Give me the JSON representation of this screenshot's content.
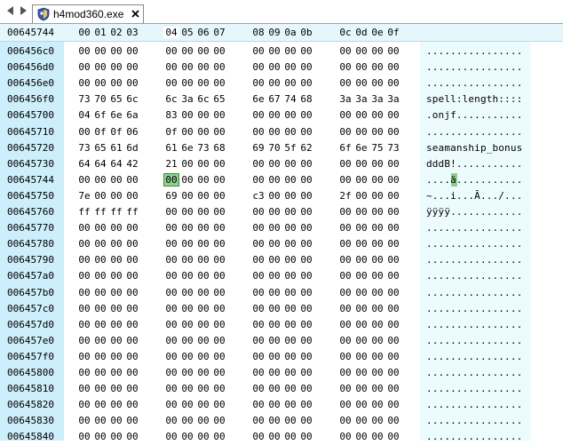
{
  "window": {
    "tab_title": "h4mod360.exe",
    "tab_icon": "shield-app-icon",
    "nav_icons": [
      "arrow-left-icon",
      "arrow-right-icon"
    ],
    "close_icon": "close-icon"
  },
  "hex": {
    "current_offset": "00645744",
    "column_headers": [
      "00",
      "01",
      "02",
      "03",
      "04",
      "05",
      "06",
      "07",
      "08",
      "09",
      "0a",
      "0b",
      "0c",
      "0d",
      "0e",
      "0f"
    ],
    "active_column": "04",
    "selected_byte": {
      "address": "00645744",
      "value": "00"
    },
    "colors": {
      "address_band": "#cdeefb",
      "ascii_band": "#ecfcfe",
      "header_band": "#e5f7fd",
      "selection": "#8fcf8f"
    },
    "rows": [
      {
        "address": "006456c0",
        "bytes": [
          "00",
          "00",
          "00",
          "00",
          "00",
          "00",
          "00",
          "00",
          "00",
          "00",
          "00",
          "00",
          "00",
          "00",
          "00",
          "00"
        ],
        "ascii": "................"
      },
      {
        "address": "006456d0",
        "bytes": [
          "00",
          "00",
          "00",
          "00",
          "00",
          "00",
          "00",
          "00",
          "00",
          "00",
          "00",
          "00",
          "00",
          "00",
          "00",
          "00"
        ],
        "ascii": "................"
      },
      {
        "address": "006456e0",
        "bytes": [
          "00",
          "00",
          "00",
          "00",
          "00",
          "00",
          "00",
          "00",
          "00",
          "00",
          "00",
          "00",
          "00",
          "00",
          "00",
          "00"
        ],
        "ascii": "................"
      },
      {
        "address": "006456f0",
        "bytes": [
          "73",
          "70",
          "65",
          "6c",
          "6c",
          "3a",
          "6c",
          "65",
          "6e",
          "67",
          "74",
          "68",
          "3a",
          "3a",
          "3a",
          "3a"
        ],
        "ascii": "spell:length::::"
      },
      {
        "address": "00645700",
        "bytes": [
          "04",
          "6f",
          "6e",
          "6a",
          "83",
          "00",
          "00",
          "00",
          "00",
          "00",
          "00",
          "00",
          "00",
          "00",
          "00",
          "00"
        ],
        "ascii": ".onjf..........."
      },
      {
        "address": "00645710",
        "bytes": [
          "00",
          "0f",
          "0f",
          "06",
          "0f",
          "00",
          "00",
          "00",
          "00",
          "00",
          "00",
          "00",
          "00",
          "00",
          "00",
          "00"
        ],
        "ascii": "................"
      },
      {
        "address": "00645720",
        "bytes": [
          "73",
          "65",
          "61",
          "6d",
          "61",
          "6e",
          "73",
          "68",
          "69",
          "70",
          "5f",
          "62",
          "6f",
          "6e",
          "75",
          "73"
        ],
        "ascii": "seamanship_bonus"
      },
      {
        "address": "00645730",
        "bytes": [
          "64",
          "64",
          "64",
          "42",
          "21",
          "00",
          "00",
          "00",
          "00",
          "00",
          "00",
          "00",
          "00",
          "00",
          "00",
          "00"
        ],
        "ascii": "dddB!..........."
      },
      {
        "address": "00645744",
        "bytes": [
          "00",
          "00",
          "00",
          "00",
          "00",
          "00",
          "00",
          "00",
          "00",
          "00",
          "00",
          "00",
          "00",
          "00",
          "00",
          "00"
        ],
        "ascii": "....ä..........."
      },
      {
        "address": "00645750",
        "bytes": [
          "7e",
          "00",
          "00",
          "00",
          "69",
          "00",
          "00",
          "00",
          "c3",
          "00",
          "00",
          "00",
          "2f",
          "00",
          "00",
          "00"
        ],
        "ascii": "~...i...Ã.../..."
      },
      {
        "address": "00645760",
        "bytes": [
          "ff",
          "ff",
          "ff",
          "ff",
          "00",
          "00",
          "00",
          "00",
          "00",
          "00",
          "00",
          "00",
          "00",
          "00",
          "00",
          "00"
        ],
        "ascii": "ÿÿÿÿ............"
      },
      {
        "address": "00645770",
        "bytes": [
          "00",
          "00",
          "00",
          "00",
          "00",
          "00",
          "00",
          "00",
          "00",
          "00",
          "00",
          "00",
          "00",
          "00",
          "00",
          "00"
        ],
        "ascii": "................"
      },
      {
        "address": "00645780",
        "bytes": [
          "00",
          "00",
          "00",
          "00",
          "00",
          "00",
          "00",
          "00",
          "00",
          "00",
          "00",
          "00",
          "00",
          "00",
          "00",
          "00"
        ],
        "ascii": "................"
      },
      {
        "address": "00645790",
        "bytes": [
          "00",
          "00",
          "00",
          "00",
          "00",
          "00",
          "00",
          "00",
          "00",
          "00",
          "00",
          "00",
          "00",
          "00",
          "00",
          "00"
        ],
        "ascii": "................"
      },
      {
        "address": "006457a0",
        "bytes": [
          "00",
          "00",
          "00",
          "00",
          "00",
          "00",
          "00",
          "00",
          "00",
          "00",
          "00",
          "00",
          "00",
          "00",
          "00",
          "00"
        ],
        "ascii": "................"
      },
      {
        "address": "006457b0",
        "bytes": [
          "00",
          "00",
          "00",
          "00",
          "00",
          "00",
          "00",
          "00",
          "00",
          "00",
          "00",
          "00",
          "00",
          "00",
          "00",
          "00"
        ],
        "ascii": "................"
      },
      {
        "address": "006457c0",
        "bytes": [
          "00",
          "00",
          "00",
          "00",
          "00",
          "00",
          "00",
          "00",
          "00",
          "00",
          "00",
          "00",
          "00",
          "00",
          "00",
          "00"
        ],
        "ascii": "................"
      },
      {
        "address": "006457d0",
        "bytes": [
          "00",
          "00",
          "00",
          "00",
          "00",
          "00",
          "00",
          "00",
          "00",
          "00",
          "00",
          "00",
          "00",
          "00",
          "00",
          "00"
        ],
        "ascii": "................"
      },
      {
        "address": "006457e0",
        "bytes": [
          "00",
          "00",
          "00",
          "00",
          "00",
          "00",
          "00",
          "00",
          "00",
          "00",
          "00",
          "00",
          "00",
          "00",
          "00",
          "00"
        ],
        "ascii": "................"
      },
      {
        "address": "006457f0",
        "bytes": [
          "00",
          "00",
          "00",
          "00",
          "00",
          "00",
          "00",
          "00",
          "00",
          "00",
          "00",
          "00",
          "00",
          "00",
          "00",
          "00"
        ],
        "ascii": "................"
      },
      {
        "address": "00645800",
        "bytes": [
          "00",
          "00",
          "00",
          "00",
          "00",
          "00",
          "00",
          "00",
          "00",
          "00",
          "00",
          "00",
          "00",
          "00",
          "00",
          "00"
        ],
        "ascii": "................"
      },
      {
        "address": "00645810",
        "bytes": [
          "00",
          "00",
          "00",
          "00",
          "00",
          "00",
          "00",
          "00",
          "00",
          "00",
          "00",
          "00",
          "00",
          "00",
          "00",
          "00"
        ],
        "ascii": "................"
      },
      {
        "address": "00645820",
        "bytes": [
          "00",
          "00",
          "00",
          "00",
          "00",
          "00",
          "00",
          "00",
          "00",
          "00",
          "00",
          "00",
          "00",
          "00",
          "00",
          "00"
        ],
        "ascii": "................"
      },
      {
        "address": "00645830",
        "bytes": [
          "00",
          "00",
          "00",
          "00",
          "00",
          "00",
          "00",
          "00",
          "00",
          "00",
          "00",
          "00",
          "00",
          "00",
          "00",
          "00"
        ],
        "ascii": "................"
      },
      {
        "address": "00645840",
        "bytes": [
          "00",
          "00",
          "00",
          "00",
          "00",
          "00",
          "00",
          "00",
          "00",
          "00",
          "00",
          "00",
          "00",
          "00",
          "00",
          "00"
        ],
        "ascii": "................"
      }
    ]
  }
}
